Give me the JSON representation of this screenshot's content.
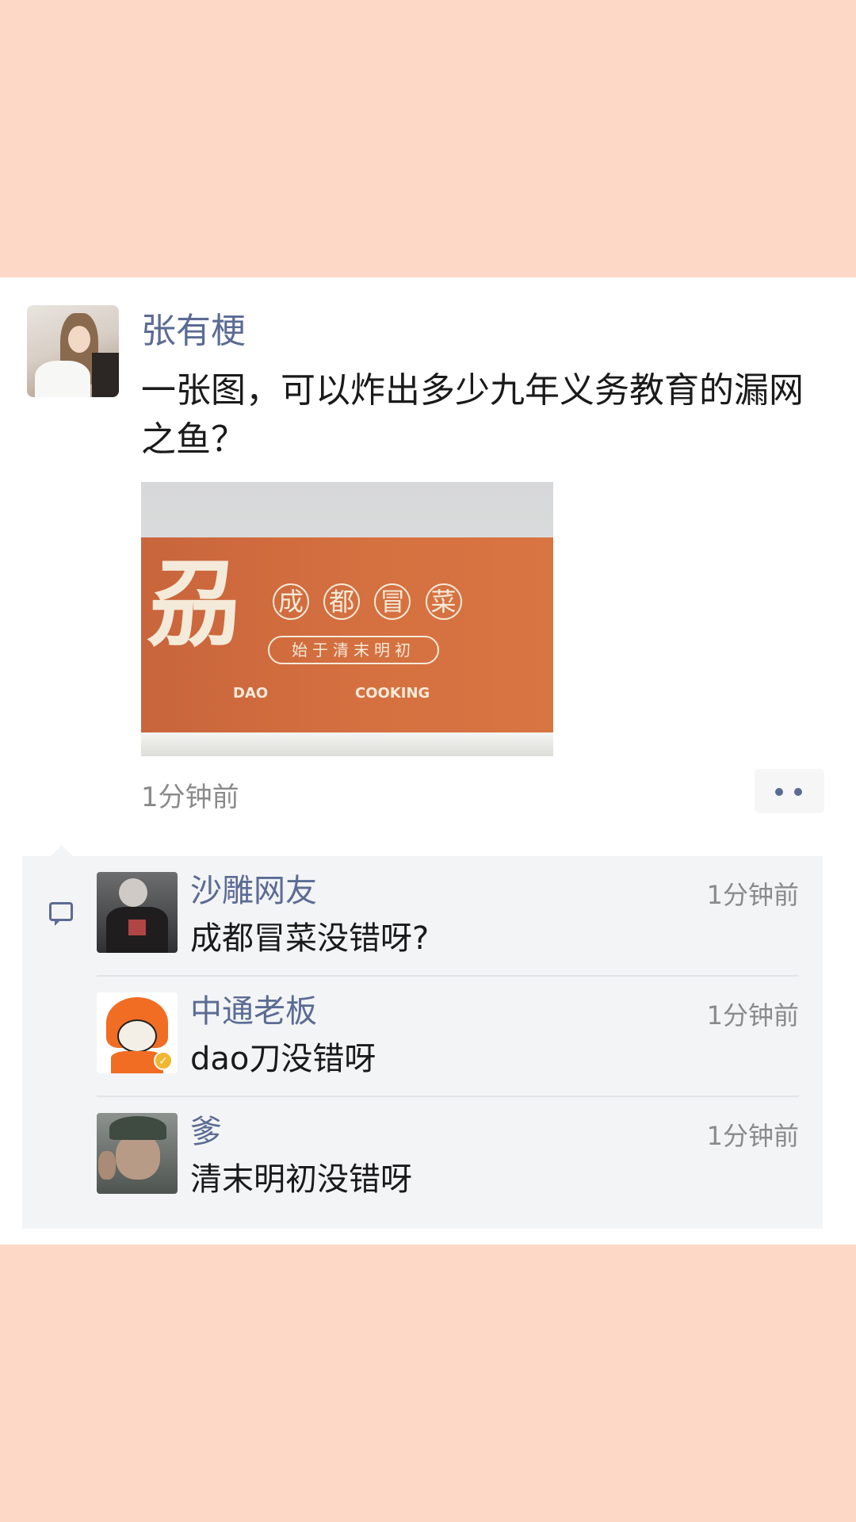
{
  "post": {
    "author": "张有梗",
    "text": "一张图，可以炸出多少九年义务教育的漏网之鱼？",
    "time": "1分钟前",
    "image": {
      "big_char": "刕",
      "brand_chars": [
        "成",
        "都",
        "冒",
        "菜"
      ],
      "slogan": "始于清末明初",
      "left_label": "DAO",
      "right_label": "COOKING"
    }
  },
  "comments": [
    {
      "name": "沙雕网友",
      "time": "1分钟前",
      "text": "成都冒菜没错呀?"
    },
    {
      "name": "中通老板",
      "time": "1分钟前",
      "text": "dao刀没错呀"
    },
    {
      "name": "爹",
      "time": "1分钟前",
      "text": "清末明初没错呀"
    }
  ],
  "icons": {
    "more": "more-dots-icon",
    "comment": "comment-bubble-icon",
    "verified": "verified-badge-icon"
  },
  "colors": {
    "background": "#fdd8c7",
    "link": "#5b6b94",
    "board": "#d57040"
  }
}
